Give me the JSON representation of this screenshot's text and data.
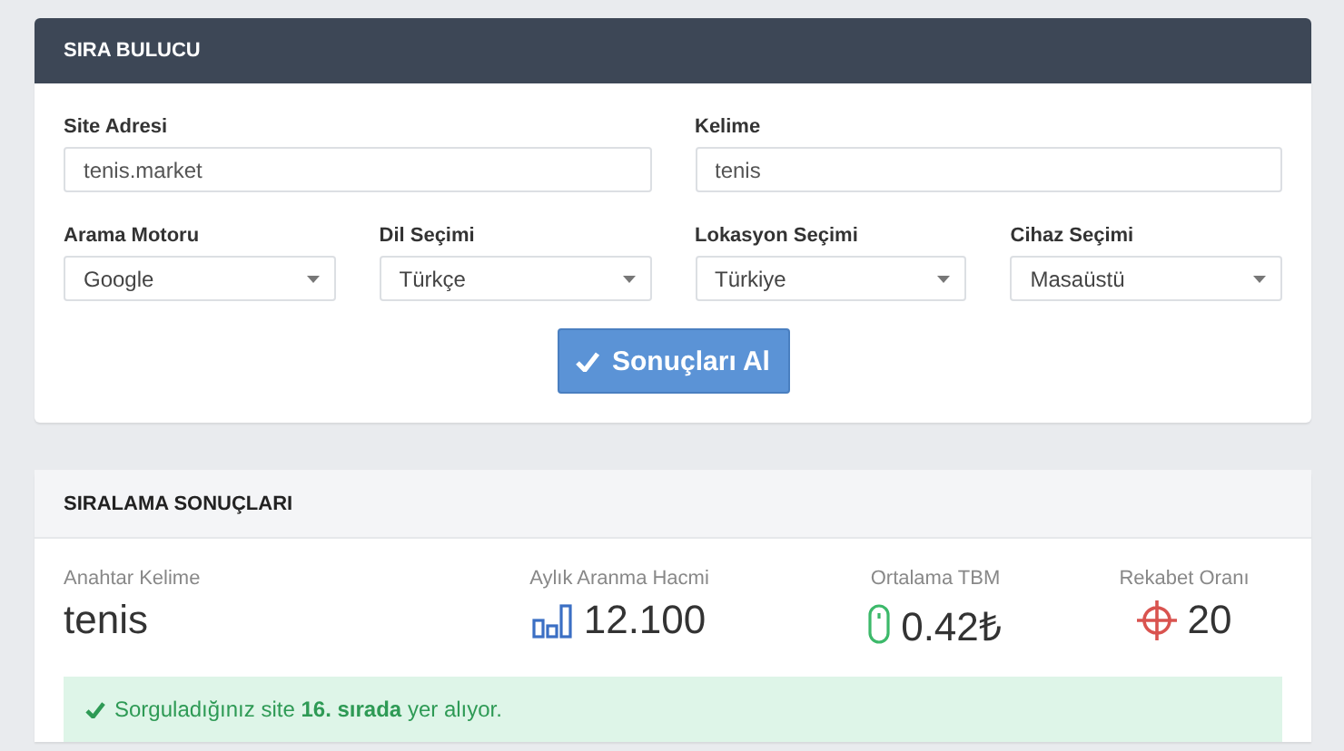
{
  "finder": {
    "title": "SIRA BULUCU",
    "text_fields": [
      {
        "label": "Site Adresi",
        "value": "tenis.market"
      },
      {
        "label": "Kelime",
        "value": "tenis"
      }
    ],
    "selects": [
      {
        "label": "Arama Motoru",
        "value": "Google"
      },
      {
        "label": "Dil Seçimi",
        "value": "Türkçe"
      },
      {
        "label": "Lokasyon Seçimi",
        "value": "Türkiye"
      },
      {
        "label": "Cihaz Seçimi",
        "value": "Masaüstü"
      }
    ],
    "submit_button": "Sonuçları Al"
  },
  "results": {
    "title": "SIRALAMA SONUÇLARI",
    "stats": [
      {
        "label": "Anahtar Kelime",
        "value": "tenis"
      },
      {
        "label": "Aylık Aranma Hacmi",
        "value": "12.100",
        "kind": "bars"
      },
      {
        "label": "Ortalama TBM",
        "value": "0.42₺",
        "kind": "mouse"
      },
      {
        "label": "Rekabet Oranı",
        "value": "20",
        "kind": "target"
      }
    ],
    "alert": "Sorguladığınız site **16. sırada** yer alıyor."
  }
}
